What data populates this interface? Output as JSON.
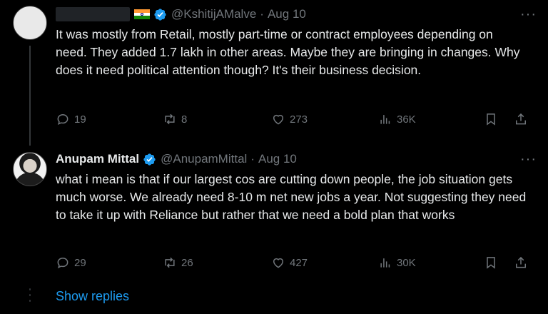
{
  "tweets": [
    {
      "display_name": "",
      "handle": "@KshitijAMalve",
      "date": "Aug 10",
      "text": "It was mostly from Retail, mostly part-time or contract employees depending on need. They added 1.7 lakh in other areas. Maybe they are bringing in changes. Why does it need political attention though? It's their business decision.",
      "replies": "19",
      "reposts": "8",
      "likes": "273",
      "views": "36K"
    },
    {
      "display_name": "Anupam Mittal",
      "handle": "@AnupamMittal",
      "date": "Aug 10",
      "text": "what i mean is that if our largest cos are cutting down people, the job situation gets much worse. We already need 8-10 m net new jobs a year. Not suggesting they need to take it up with Reliance but rather that we need a bold plan that works",
      "replies": "29",
      "reposts": "26",
      "likes": "427",
      "views": "30K"
    }
  ],
  "more_glyph": "···",
  "separator": "·",
  "show_replies": "Show replies",
  "colors": {
    "accent": "#1d9bf0",
    "muted": "#71767b",
    "text": "#e7e9ea",
    "background": "#000000"
  }
}
